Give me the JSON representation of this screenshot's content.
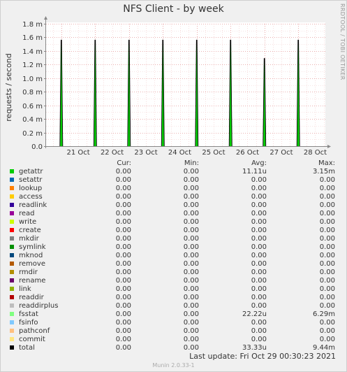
{
  "title": "NFS Client - by week",
  "watermark": "RRDTOOL / TOBI OETIKER",
  "chart_data": {
    "type": "line",
    "title": "NFS Client - by week",
    "ylabel": "requests / second",
    "ylim": [
      0,
      1.8
    ],
    "yticks": [
      "0.0",
      "0.2 m",
      "0.4 m",
      "0.6 m",
      "0.8 m",
      "1.0 m",
      "1.2 m",
      "1.4 m",
      "1.6 m",
      "1.8 m"
    ],
    "xticks": [
      "21 Oct",
      "22 Oct",
      "23 Oct",
      "24 Oct",
      "25 Oct",
      "26 Oct",
      "27 Oct",
      "28 Oct"
    ],
    "x_day_start": 20.55,
    "x_day_end": 28.8,
    "grid": true,
    "series": [
      {
        "name": "total",
        "color": "#000000",
        "points": [
          {
            "x": 21.0,
            "y": 1.56
          },
          {
            "x": 22.0,
            "y": 1.56
          },
          {
            "x": 23.0,
            "y": 1.56
          },
          {
            "x": 24.0,
            "y": 1.56
          },
          {
            "x": 25.0,
            "y": 1.56
          },
          {
            "x": 26.0,
            "y": 1.56
          },
          {
            "x": 27.0,
            "y": 1.29
          },
          {
            "x": 28.0,
            "y": 1.56
          }
        ]
      }
    ]
  },
  "legend": {
    "headers": {
      "cur": "Cur:",
      "min": "Min:",
      "avg": "Avg:",
      "max": "Max:"
    },
    "rows": [
      {
        "name": "getattr",
        "color": "#00cc00",
        "cur": "0.00",
        "min": "0.00",
        "avg": "11.11u",
        "max": "3.15m"
      },
      {
        "name": "setattr",
        "color": "#0066b3",
        "cur": "0.00",
        "min": "0.00",
        "avg": "0.00",
        "max": "0.00"
      },
      {
        "name": "lookup",
        "color": "#ff8000",
        "cur": "0.00",
        "min": "0.00",
        "avg": "0.00",
        "max": "0.00"
      },
      {
        "name": "access",
        "color": "#ffcc00",
        "cur": "0.00",
        "min": "0.00",
        "avg": "0.00",
        "max": "0.00"
      },
      {
        "name": "readlink",
        "color": "#330099",
        "cur": "0.00",
        "min": "0.00",
        "avg": "0.00",
        "max": "0.00"
      },
      {
        "name": "read",
        "color": "#990099",
        "cur": "0.00",
        "min": "0.00",
        "avg": "0.00",
        "max": "0.00"
      },
      {
        "name": "write",
        "color": "#ccff00",
        "cur": "0.00",
        "min": "0.00",
        "avg": "0.00",
        "max": "0.00"
      },
      {
        "name": "create",
        "color": "#ff0000",
        "cur": "0.00",
        "min": "0.00",
        "avg": "0.00",
        "max": "0.00"
      },
      {
        "name": "mkdir",
        "color": "#808080",
        "cur": "0.00",
        "min": "0.00",
        "avg": "0.00",
        "max": "0.00"
      },
      {
        "name": "symlink",
        "color": "#008f00",
        "cur": "0.00",
        "min": "0.00",
        "avg": "0.00",
        "max": "0.00"
      },
      {
        "name": "mknod",
        "color": "#00487d",
        "cur": "0.00",
        "min": "0.00",
        "avg": "0.00",
        "max": "0.00"
      },
      {
        "name": "remove",
        "color": "#b35a00",
        "cur": "0.00",
        "min": "0.00",
        "avg": "0.00",
        "max": "0.00"
      },
      {
        "name": "rmdir",
        "color": "#b38f00",
        "cur": "0.00",
        "min": "0.00",
        "avg": "0.00",
        "max": "0.00"
      },
      {
        "name": "rename",
        "color": "#6b006b",
        "cur": "0.00",
        "min": "0.00",
        "avg": "0.00",
        "max": "0.00"
      },
      {
        "name": "link",
        "color": "#8fb300",
        "cur": "0.00",
        "min": "0.00",
        "avg": "0.00",
        "max": "0.00"
      },
      {
        "name": "readdir",
        "color": "#b30000",
        "cur": "0.00",
        "min": "0.00",
        "avg": "0.00",
        "max": "0.00"
      },
      {
        "name": "readdirplus",
        "color": "#bebebe",
        "cur": "0.00",
        "min": "0.00",
        "avg": "0.00",
        "max": "0.00"
      },
      {
        "name": "fsstat",
        "color": "#80ff80",
        "cur": "0.00",
        "min": "0.00",
        "avg": "22.22u",
        "max": "6.29m"
      },
      {
        "name": "fsinfo",
        "color": "#80c9ff",
        "cur": "0.00",
        "min": "0.00",
        "avg": "0.00",
        "max": "0.00"
      },
      {
        "name": "pathconf",
        "color": "#ffc080",
        "cur": "0.00",
        "min": "0.00",
        "avg": "0.00",
        "max": "0.00"
      },
      {
        "name": "commit",
        "color": "#ffe680",
        "cur": "0.00",
        "min": "0.00",
        "avg": "0.00",
        "max": "0.00"
      },
      {
        "name": "total",
        "color": "#000000",
        "cur": "0.00",
        "min": "0.00",
        "avg": "33.33u",
        "max": "9.44m"
      }
    ]
  },
  "last_update": "Last update:  Fri Oct 29 00:30:23 2021",
  "footer": "Munin 2.0.33-1"
}
